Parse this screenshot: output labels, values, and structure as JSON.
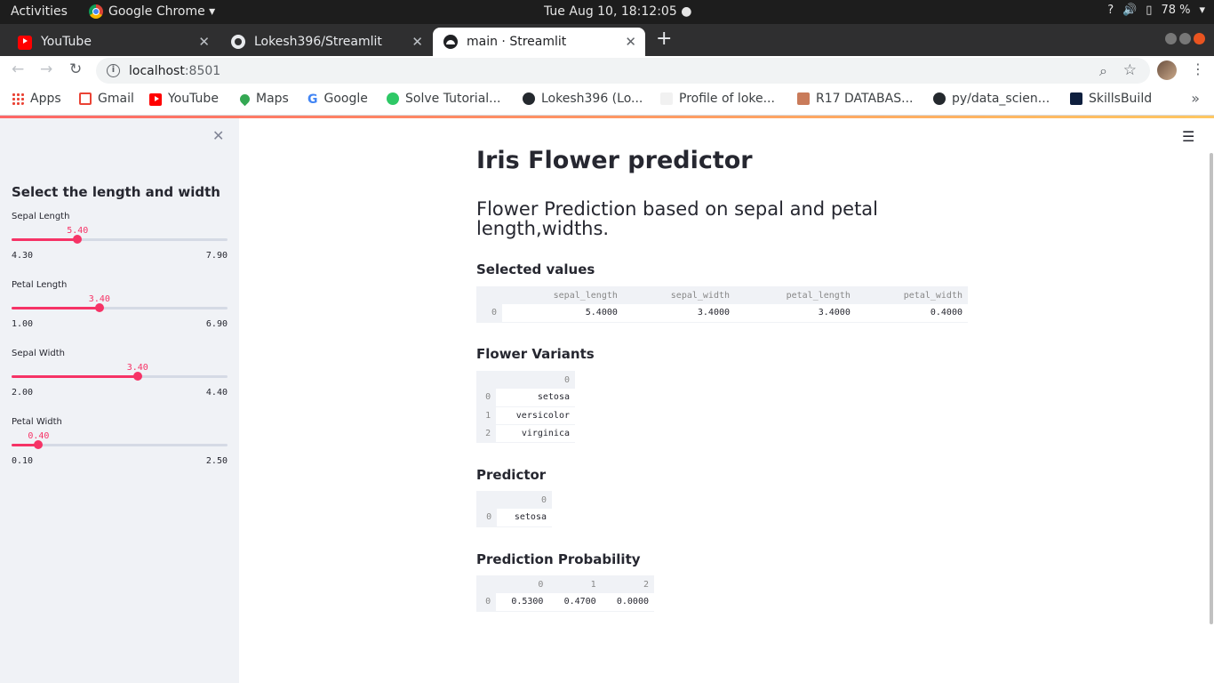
{
  "os": {
    "activities": "Activities",
    "app_name": "Google Chrome ▾",
    "clock": "Tue Aug 10, 18:12:05 ●",
    "battery": "78 %"
  },
  "tabs": [
    {
      "label": "YouTube"
    },
    {
      "label": "Lokesh396/Streamlit"
    },
    {
      "label": "main · Streamlit"
    }
  ],
  "address": {
    "host": "localhost",
    "port": ":8501"
  },
  "bookmarks": [
    {
      "label": "Apps"
    },
    {
      "label": "Gmail"
    },
    {
      "label": "YouTube"
    },
    {
      "label": "Maps"
    },
    {
      "label": "Google"
    },
    {
      "label": "Solve Tutorial..."
    },
    {
      "label": "Lokesh396 (Lo..."
    },
    {
      "label": "Profile of loke..."
    },
    {
      "label": "R17 DATABAS..."
    },
    {
      "label": "py/data_scien..."
    },
    {
      "label": "SkillsBuild"
    }
  ],
  "sidebar": {
    "title": "Select the length and width",
    "sliders": [
      {
        "label": "Sepal Length",
        "value": "5.40",
        "min": "4.30",
        "max": "7.90",
        "fraction": 0.3056
      },
      {
        "label": "Petal Length",
        "value": "3.40",
        "min": "1.00",
        "max": "6.90",
        "fraction": 0.4068
      },
      {
        "label": "Sepal Width",
        "value": "3.40",
        "min": "2.00",
        "max": "4.40",
        "fraction": 0.5833
      },
      {
        "label": "Petal Width",
        "value": "0.40",
        "min": "0.10",
        "max": "2.50",
        "fraction": 0.125
      }
    ]
  },
  "main": {
    "title": "Iris Flower predictor",
    "subtitle": "Flower Prediction based on sepal and petal length,widths.",
    "selected_header": "Selected values",
    "selected_table": {
      "columns": [
        "sepal_length",
        "sepal_width",
        "petal_length",
        "petal_width"
      ],
      "rows": [
        {
          "index": "0",
          "cells": [
            "5.4000",
            "3.4000",
            "3.4000",
            "0.4000"
          ]
        }
      ]
    },
    "variants_header": "Flower Variants",
    "variants_table": {
      "columns": [
        "0"
      ],
      "rows": [
        {
          "index": "0",
          "cells": [
            "setosa"
          ]
        },
        {
          "index": "1",
          "cells": [
            "versicolor"
          ]
        },
        {
          "index": "2",
          "cells": [
            "virginica"
          ]
        }
      ]
    },
    "predictor_header": "Predictor",
    "predictor_table": {
      "columns": [
        "0"
      ],
      "rows": [
        {
          "index": "0",
          "cells": [
            "setosa"
          ]
        }
      ]
    },
    "probability_header": "Prediction Probability",
    "probability_table": {
      "columns": [
        "0",
        "1",
        "2"
      ],
      "rows": [
        {
          "index": "0",
          "cells": [
            "0.5300",
            "0.4700",
            "0.0000"
          ]
        }
      ]
    }
  }
}
